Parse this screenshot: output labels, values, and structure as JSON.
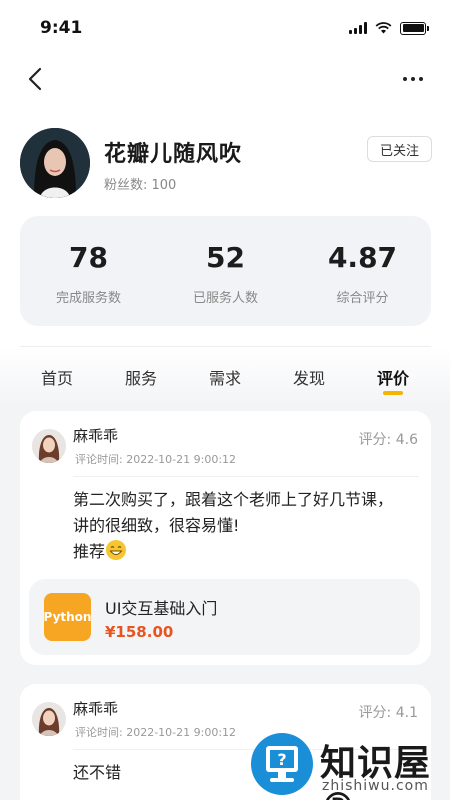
{
  "status": {
    "time": "9:41"
  },
  "profile": {
    "name": "花瓣儿随风吹",
    "fans_label": "粉丝数:",
    "fans": "100",
    "fans_text": "粉丝数: 100",
    "follow_label": "已关注"
  },
  "stats": [
    {
      "value": "78",
      "label": "完成服务数"
    },
    {
      "value": "52",
      "label": "已服务人数"
    },
    {
      "value": "4.87",
      "label": "综合评分"
    }
  ],
  "tabs": [
    {
      "label": "首页",
      "active": false
    },
    {
      "label": "服务",
      "active": false
    },
    {
      "label": "需求",
      "active": false
    },
    {
      "label": "发现",
      "active": false
    },
    {
      "label": "评价",
      "active": true
    }
  ],
  "reviews": [
    {
      "user": "麻乖乖",
      "time": "评论时间: 2022-10-21 9:00:12",
      "score": "评分: 4.6",
      "lines": [
        "第二次购买了，跟着这个老师上了好几节课，",
        "讲的很细致，很容易懂!",
        "推荐"
      ],
      "product": {
        "thumb": "Python",
        "title": "UI交互基础入门",
        "price": "¥158.00"
      }
    },
    {
      "user": "麻乖乖",
      "time": "评论时间: 2022-10-21 9:00:12",
      "score": "评分: 4.1",
      "lines": [
        "还不错"
      ]
    }
  ],
  "watermark": {
    "title": "知识屋®",
    "sub": "zhishiwu.com"
  },
  "colors": {
    "accent": "#f5b400",
    "price": "#e8541e",
    "card_bg": "#f2f3f6"
  },
  "icons": [
    "back-icon",
    "more-icon",
    "signal-icon",
    "wifi-icon",
    "battery-icon",
    "grin-emoji-icon"
  ]
}
